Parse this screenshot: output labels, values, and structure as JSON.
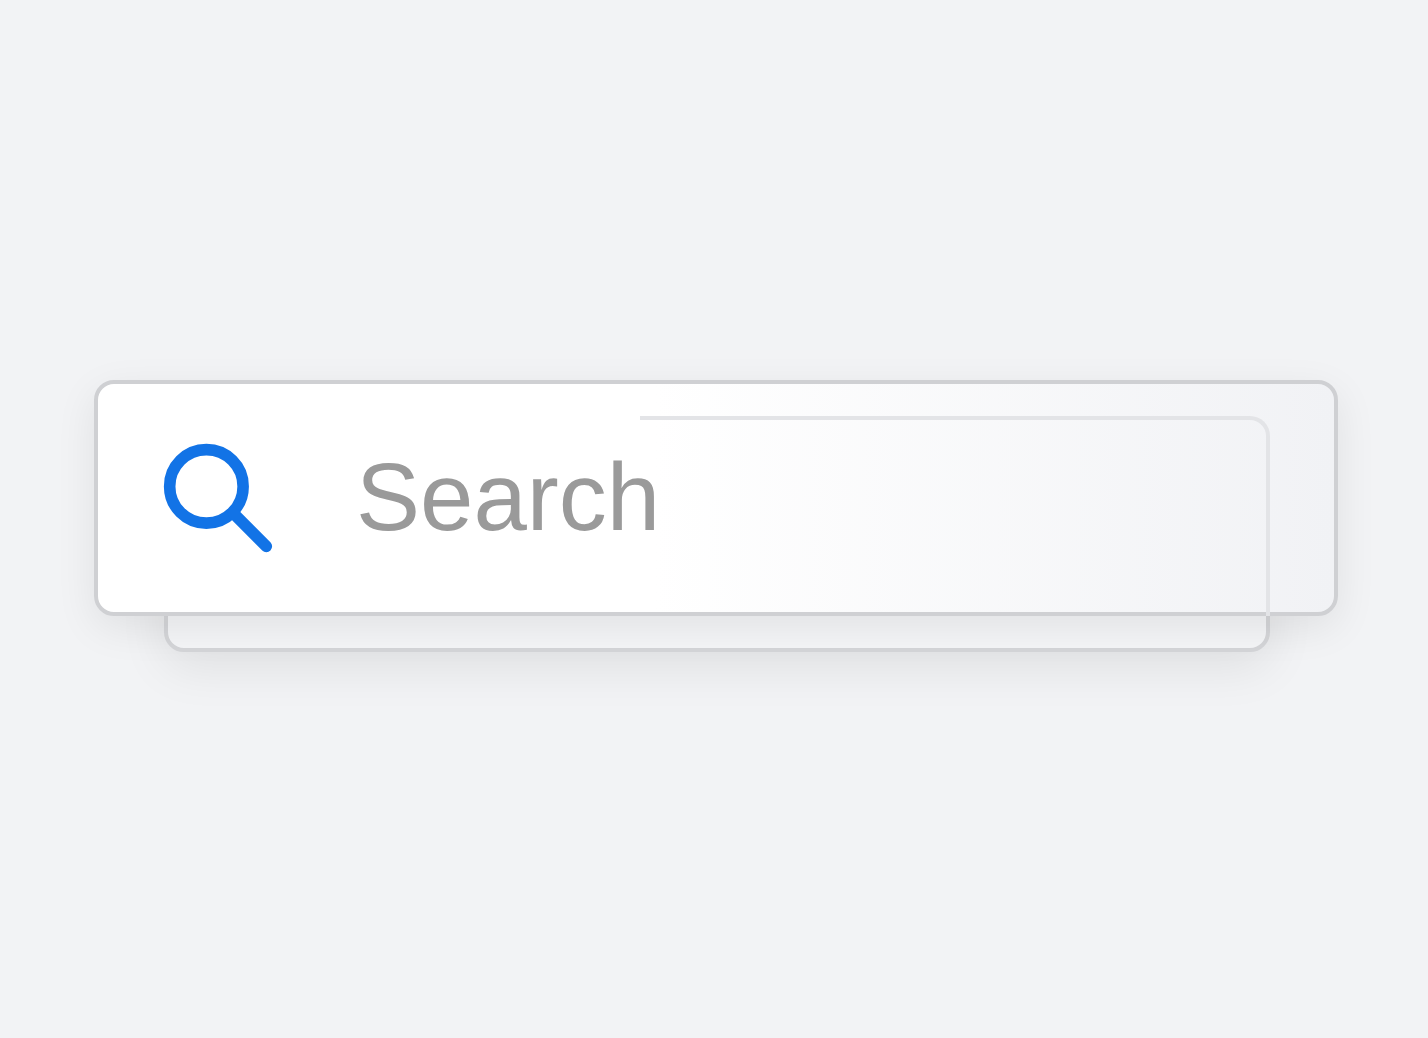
{
  "search": {
    "placeholder": "Search"
  }
}
